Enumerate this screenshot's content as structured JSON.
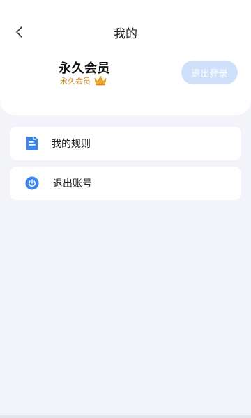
{
  "header": {
    "title": "我的",
    "back_icon": "chevron-left-icon"
  },
  "profile": {
    "name": "永久会员",
    "membership_label": "永久会员",
    "crown_icon": "crown-icon",
    "logout_label": "退出登录"
  },
  "menu": {
    "items": [
      {
        "label": "我的规则",
        "icon": "document-icon"
      },
      {
        "label": "退出账号",
        "icon": "power-icon"
      }
    ]
  },
  "colors": {
    "accent": "#3d86e8",
    "member_gold": "#c98a1e",
    "logout_button_bg": "#cfe0fb",
    "background": "#f3f4f9"
  }
}
